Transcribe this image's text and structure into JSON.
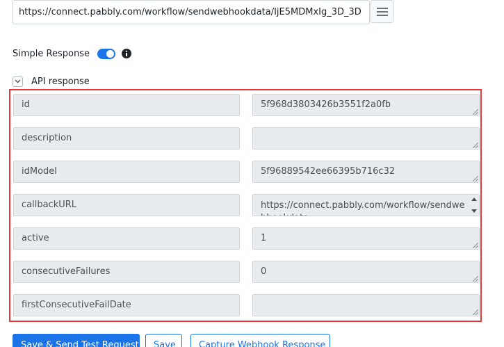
{
  "webhook": {
    "url": "https://connect.pabbly.com/workflow/sendwebhookdata/IjE5MDMxIg_3D_3D"
  },
  "simple_response": {
    "label": "Simple Response",
    "enabled": true
  },
  "api_response": {
    "label": "API response",
    "fields": [
      {
        "key": "id",
        "value": "5f968d3803426b3551f2a0fb"
      },
      {
        "key": "description",
        "value": ""
      },
      {
        "key": "idModel",
        "value": "5f96889542ee66395b716c32"
      },
      {
        "key": "callbackURL",
        "value": "https://connect.pabbly.com/workflow/sendwebhookdata"
      },
      {
        "key": "active",
        "value": "1"
      },
      {
        "key": "consecutiveFailures",
        "value": "0"
      },
      {
        "key": "firstConsecutiveFailDate",
        "value": ""
      }
    ]
  },
  "actions": {
    "save_send_label": "Save & Send Test Request",
    "save_label": "Save",
    "capture_label": "Capture Webhook Response"
  },
  "colors": {
    "accent": "#1b73e8",
    "highlight_border": "#e53935"
  }
}
